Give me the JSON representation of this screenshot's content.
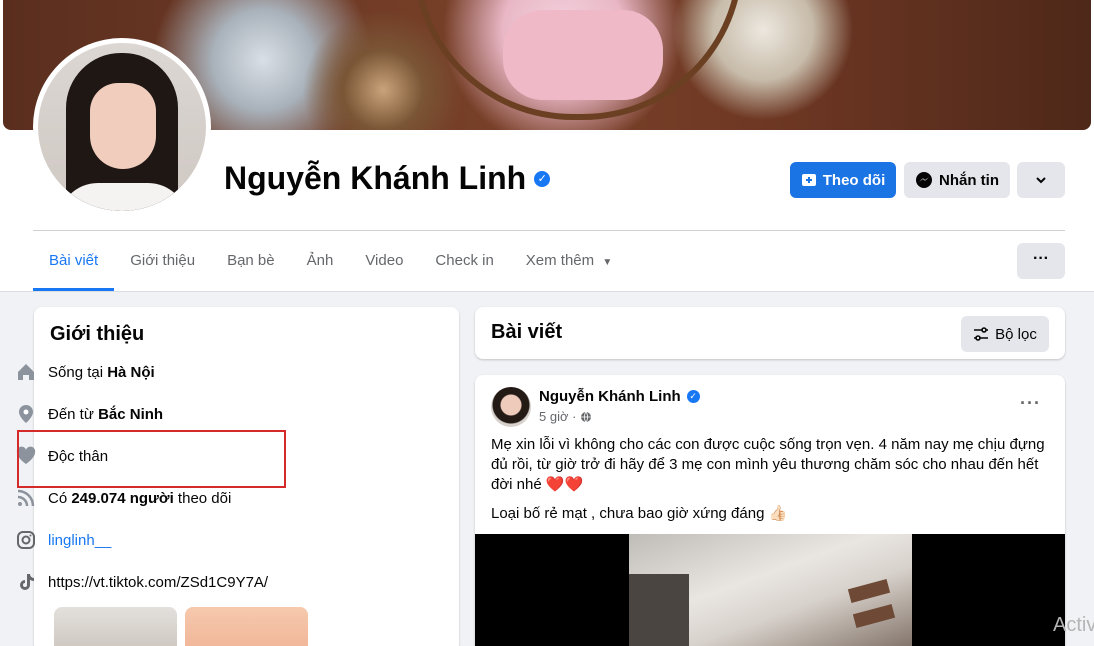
{
  "profile": {
    "name": "Nguyễn Khánh Linh",
    "verified_glyph": "✓",
    "follow_label": "Theo dõi",
    "message_label": "Nhắn tin"
  },
  "tabs": [
    "Bài viết",
    "Giới thiệu",
    "Bạn bè",
    "Ảnh",
    "Video",
    "Check in",
    "Xem thêm"
  ],
  "intro": {
    "title": "Giới thiệu",
    "lives_prefix": "Sống tại ",
    "lives_place": "Hà Nội",
    "from_prefix": "Đến từ ",
    "from_place": "Bắc Ninh",
    "relationship": "Độc thân",
    "followers_prefix": "Có ",
    "followers_count": "249.074 người",
    "followers_suffix": " theo dõi",
    "instagram": "linglinh__",
    "tiktok": "https://vt.tiktok.com/ZSd1C9Y7A/"
  },
  "posts": {
    "title": "Bài viết",
    "filter_label": "Bộ lọc"
  },
  "post": {
    "author": "Nguyễn Khánh Linh",
    "time": "5 giờ ·",
    "text": "Mẹ xin lỗi vì không cho các con được cuộc sống trọn vẹn. 4 năm nay mẹ chịu đựng đủ rồi, từ giờ trở đi hãy để 3 mẹ con mình yêu thương chăm sóc cho nhau đến hết đời nhé ❤️❤️",
    "text2": "Loại bố rẻ mạt , chưa bao giờ xứng đáng 👍🏻"
  },
  "watermark": "Activ",
  "colors": {
    "accent": "#1877f2",
    "highlight": "#d42a2a"
  }
}
